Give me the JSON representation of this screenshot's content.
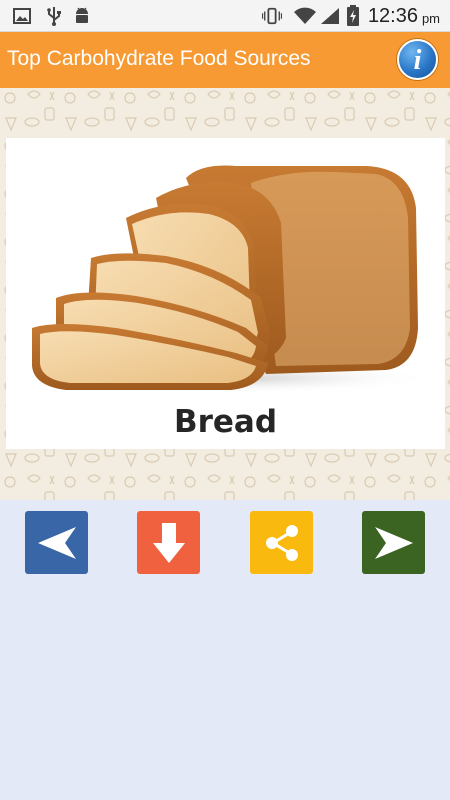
{
  "status_bar": {
    "time": "12:36",
    "ampm": "pm",
    "icons": [
      "image-icon",
      "usb-icon",
      "android-icon",
      "vibrate-icon",
      "wifi-icon",
      "signal-icon",
      "battery-icon"
    ]
  },
  "app_bar": {
    "title": "Top Carbohydrate Food Sources",
    "info_icon": "info-icon"
  },
  "food_card": {
    "name": "Bread",
    "image": "bread-loaf-image"
  },
  "controls": [
    {
      "icon": "arrow-left-icon",
      "color": "#3966a6"
    },
    {
      "icon": "download-icon",
      "color": "#f06140"
    },
    {
      "icon": "share-icon",
      "color": "#f9b90f"
    },
    {
      "icon": "arrow-right-icon",
      "color": "#3b6321"
    }
  ],
  "colors": {
    "app_bar": "#f79a34",
    "background": "#e4e9f8",
    "pattern_bg": "#f3ece0"
  }
}
